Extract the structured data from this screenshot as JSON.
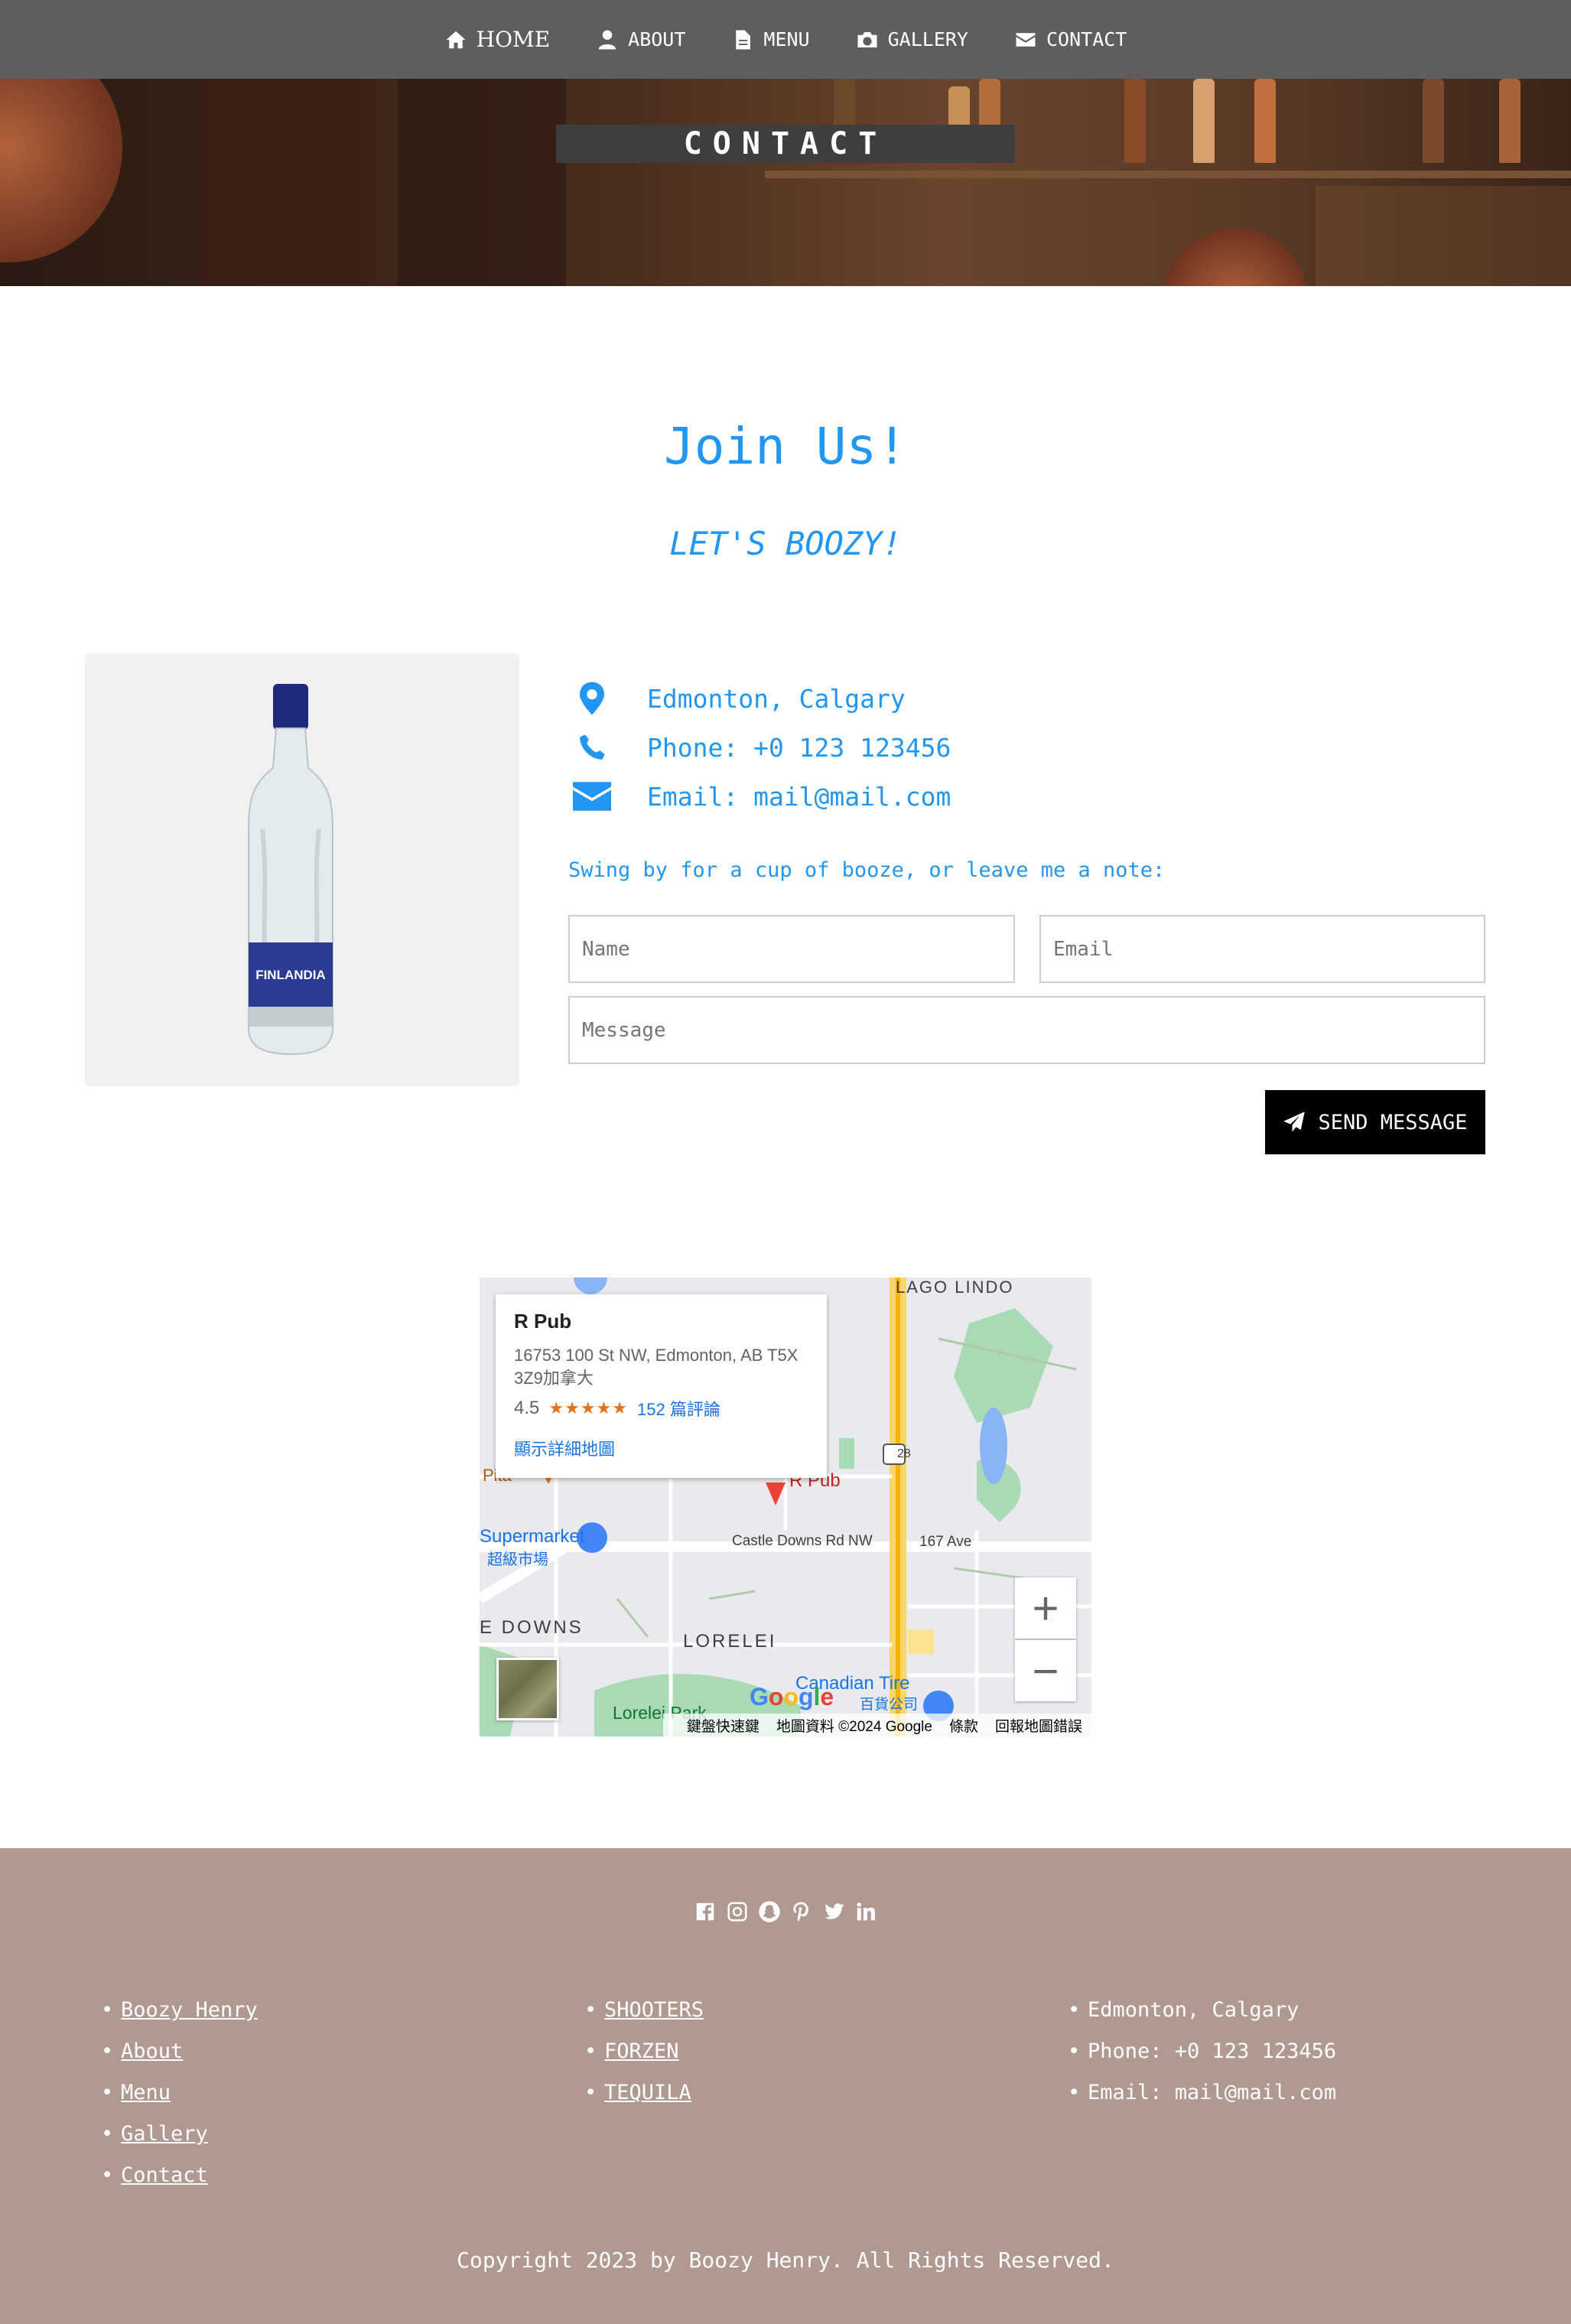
{
  "nav": {
    "items": [
      {
        "label": "HOME",
        "icon": "home-icon"
      },
      {
        "label": "ABOUT",
        "icon": "user-icon"
      },
      {
        "label": "MENU",
        "icon": "file-icon"
      },
      {
        "label": "GALLERY",
        "icon": "camera-icon"
      },
      {
        "label": "CONTACT",
        "icon": "envelope-icon"
      }
    ]
  },
  "hero": {
    "title": "CONTACT"
  },
  "join": {
    "title": "Join Us!",
    "subtitle": "LET'S BOOZY!"
  },
  "product": {
    "bottle_label": "FINLANDIA"
  },
  "contact": {
    "location": "Edmonton, Calgary",
    "phone": "Phone: +0 123 123456",
    "email": "Email: mail@mail.com",
    "note": "Swing by for a cup of booze, or leave me a note:"
  },
  "form": {
    "name_placeholder": "Name",
    "email_placeholder": "Email",
    "message_placeholder": "Message",
    "send_label": "SEND MESSAGE"
  },
  "map": {
    "place_name": "R Pub",
    "address": "16753 100 St NW, Edmonton, AB T5X 3Z9加拿大",
    "rating": "4.5",
    "stars": "★★★★★",
    "reviews": "152 篇評論",
    "more_link": "顯示詳細地圖",
    "labels": {
      "lago_lindo": "LAGO LINDO",
      "supermarket": "Supermarket",
      "supermarket_cn": "超級市場",
      "castle_downs": "Castle Downs Rd NW",
      "ave_167": "167 Ave",
      "e_downs": "E DOWNS",
      "lorelei": "LORELEI",
      "canadian_tire": "Canadian Tire",
      "canadian_tire_cn": "百貨公司",
      "lorelei_park": "Lorelei Park",
      "highway": "28",
      "marker": "R Pub",
      "pita": "Pita"
    },
    "google": "Google",
    "zoom_in": "+",
    "zoom_out": "−",
    "footer": [
      "鍵盤快速鍵",
      "地圖資料 ©2024 Google",
      "條款",
      "回報地圖錯誤"
    ]
  },
  "footer": {
    "socials": [
      "facebook-icon",
      "instagram-icon",
      "snapchat-icon",
      "pinterest-icon",
      "twitter-icon",
      "linkedin-icon"
    ],
    "col1": [
      "Boozy Henry",
      "About",
      "Menu",
      "Gallery",
      "Contact"
    ],
    "col2": [
      "SHOOTERS",
      "FORZEN",
      "TEQUILA"
    ],
    "col3": [
      "Edmonton, Calgary",
      "Phone: +0 123 123456",
      "Email: mail@mail.com"
    ],
    "copyright": "Copyright 2023 by Boozy Henry. All Rights Reserved."
  },
  "colors": {
    "accent": "#2196f3",
    "nav_bg": "#5e5e5e",
    "footer_bg": "#b09990",
    "button_bg": "#000000"
  }
}
